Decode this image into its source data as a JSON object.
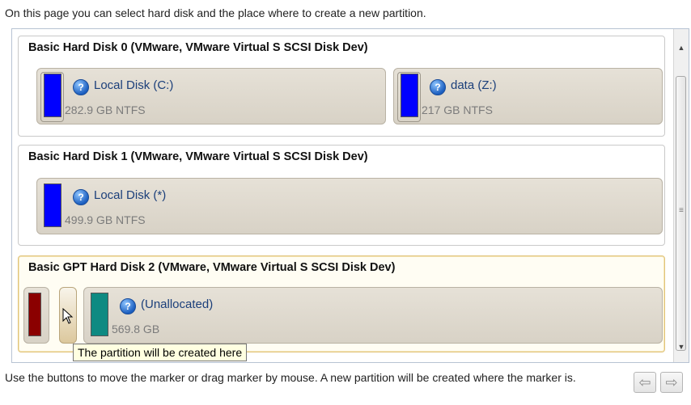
{
  "instruction_top": "On this page you can select hard disk and the place where to create a new partition.",
  "disks": [
    {
      "title": "Basic Hard Disk 0 (VMware, VMware Virtual S SCSI Disk Dev)",
      "partitions": [
        {
          "label": "Local Disk (C:)",
          "size": "282.9 GB NTFS",
          "color": "#0000ff"
        },
        {
          "label": "data (Z:)",
          "size": "217 GB NTFS",
          "color": "#0000ff"
        }
      ]
    },
    {
      "title": "Basic Hard Disk 1 (VMware, VMware Virtual S SCSI Disk Dev)",
      "partitions": [
        {
          "label": "Local Disk (*)",
          "size": "499.9 GB NTFS",
          "color": "#0000ff"
        }
      ]
    },
    {
      "title": "Basic GPT Hard Disk 2 (VMware, VMware Virtual S SCSI Disk Dev)",
      "partitions": [
        {
          "label": "",
          "size": "",
          "color": "#8b0000"
        },
        {
          "label": "(Unallocated)",
          "size": "569.8 GB",
          "color": "#0e8a82"
        }
      ]
    }
  ],
  "tooltip": "The partition will be created here",
  "instruction_bottom": "Use the buttons to move the marker or drag marker by mouse. A new partition will be created where the marker is.",
  "icons": {
    "help": "question-circle-icon",
    "scroll_up": "scroll-up-arrow-icon",
    "scroll_down": "scroll-down-arrow-icon",
    "move_left": "arrow-left-icon",
    "move_right": "arrow-right-icon",
    "cursor": "mouse-pointer-icon"
  }
}
